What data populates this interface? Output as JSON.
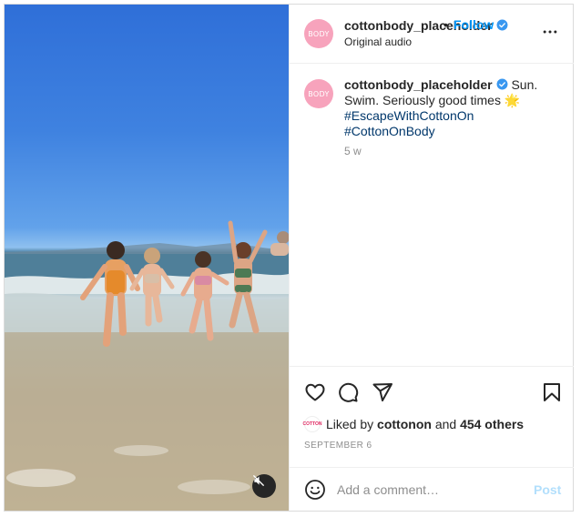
{
  "post": {
    "account": {
      "username": "cottonbody_placeholder",
      "avatar_text": "BODY",
      "verified": true
    },
    "header": {
      "username": "cottonbody_placeholder",
      "separator": "•",
      "follow_label": "Follow",
      "audio_label": "Original audio",
      "more_icon": "more-horizontal-icon"
    },
    "caption": {
      "username": "cottonbody_placeholder",
      "text": "Sun. Swim. Seriously good times 🌟",
      "hashtags": [
        "#EscapeWithCottonOn",
        "#CottonOnBody"
      ],
      "age": "5 w"
    },
    "actions": {
      "like_icon": "heart-icon",
      "comment_icon": "comment-icon",
      "share_icon": "send-icon",
      "save_icon": "bookmark-icon"
    },
    "likes": {
      "prefix": "Liked by",
      "liked_by_user": "cottonon",
      "middle": "and",
      "others": "454 others",
      "mini_avatar_text": "COTTON"
    },
    "date": "SEPTEMBER 6",
    "comment_box": {
      "emoji_icon": "emoji-icon",
      "placeholder": "Add a comment…",
      "post_label": "Post"
    },
    "media": {
      "mute_icon": "muted-speaker-icon"
    },
    "colors": {
      "link_blue": "#0095f6",
      "hashtag_blue": "#00376b",
      "avatar_pink": "#f7a3bc",
      "secondary_text": "#8e8e8e",
      "verified_blue": "#3897f0"
    }
  }
}
